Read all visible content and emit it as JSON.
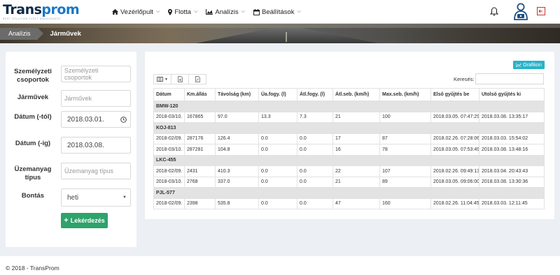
{
  "app": {
    "logo_main": "Trans",
    "logo_accent": "prom",
    "logo_tagline": "best solution fleet management"
  },
  "nav": {
    "items": [
      {
        "label": "Vezérlőpult",
        "icon": "home-icon"
      },
      {
        "label": "Flotta",
        "icon": "map-marker-icon"
      },
      {
        "label": "Analízis",
        "icon": "area-chart-icon"
      },
      {
        "label": "Beállítások",
        "icon": "calendar-icon"
      }
    ],
    "right_icons": [
      "bell-icon",
      "user-account-icon",
      "logout-icon"
    ]
  },
  "breadcrumb": {
    "first": "Analízis",
    "second": "Járművek"
  },
  "filters": {
    "personnel_group": {
      "label": "Személyzeti csoportok",
      "placeholder": "Személyzeti csoportok"
    },
    "vehicles": {
      "label": "Járművek",
      "placeholder": "Járművek"
    },
    "date_from": {
      "label": "Dátum (-tól)",
      "value": "2018.03.01."
    },
    "date_to": {
      "label": "Dátum (-ig)",
      "value": "2018.03.08."
    },
    "fuel_type": {
      "label": "Üzemanyag típus",
      "placeholder": "Üzemanyag típus"
    },
    "breakdown": {
      "label": "Bontás",
      "value": "heti"
    },
    "submit_label": "Lekérdezés"
  },
  "table_panel": {
    "graph_button": "Grafikon",
    "search_label": "Keresés:",
    "columns": [
      "Dátum",
      "Km.állás",
      "Távolság (km)",
      "Üa.fogy. (l)",
      "Átl.fogy. (l)",
      "Átl.seb. (km/h)",
      "Max.seb. (km/h)",
      "Első gyűjtés be",
      "Utolsó gyűjtés ki"
    ],
    "groups": [
      {
        "name": "BMW-120",
        "rows": [
          [
            "2018-03/10.",
            "167865",
            "97.0",
            "13.3",
            "7.3",
            "21",
            "100",
            "2018.03.05. 07:47:29",
            "2018.03.08. 13:35:17"
          ]
        ]
      },
      {
        "name": "KOJ-813",
        "rows": [
          [
            "2018-02/09.",
            "287176",
            "126.4",
            "0.0",
            "0.0",
            "17",
            "87",
            "2018.02.26. 07:28:06",
            "2018.03.03. 15:54:02"
          ],
          [
            "2018-03/10.",
            "287281",
            "104.8",
            "0.0",
            "0.0",
            "16",
            "78",
            "2018.03.05. 07:53:49",
            "2018.03.08. 13:48:16"
          ]
        ]
      },
      {
        "name": "LKC-455",
        "rows": [
          [
            "2018-02/09.",
            "2431",
            "410.3",
            "0.0",
            "0.0",
            "22",
            "107",
            "2018.02.26. 09:49:13",
            "2018.03.04. 20:43:43"
          ],
          [
            "2018-03/10.",
            "2768",
            "337.0",
            "0.0",
            "0.0",
            "21",
            "89",
            "2018.03.05. 09:06:00",
            "2018.03.08. 13:30:36"
          ]
        ]
      },
      {
        "name": "PJL-577",
        "rows": [
          [
            "2018-02/09.",
            "2398",
            "535.8",
            "0.0",
            "0.0",
            "47",
            "160",
            "2018.02.26. 11:04:45",
            "2018.03.03. 12:11:45"
          ]
        ]
      }
    ]
  },
  "footer": {
    "text": "© 2018 - TransProm"
  },
  "colors": {
    "primary_button": "#2ea36b",
    "graph_button": "#2ab3c6",
    "brand_dark": "#0e2a47",
    "brand_accent": "#1a77c9"
  }
}
